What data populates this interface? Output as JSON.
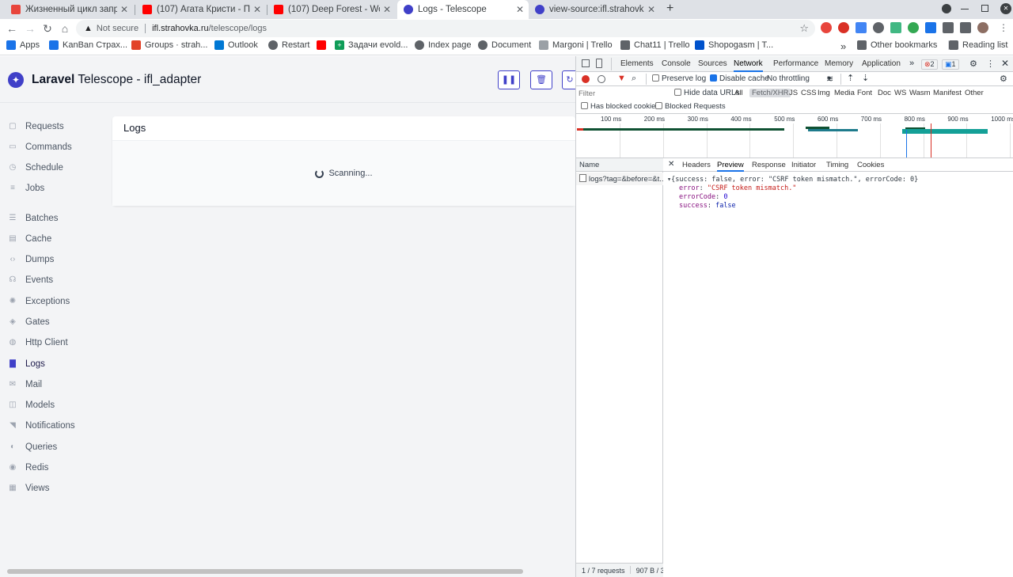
{
  "browser": {
    "tabs": [
      {
        "title": "Жизненный цикл запрос",
        "color": "#e8453c"
      },
      {
        "title": "(107) Агата Кристи - Пуля",
        "color": "#ff0000"
      },
      {
        "title": "(107) Deep Forest - World",
        "color": "#ff0000"
      },
      {
        "title": "Logs - Telescope",
        "color": "#4040c8"
      },
      {
        "title": "view-source:ifl.strahovka",
        "color": "#4040c8"
      }
    ],
    "new_tab": "+",
    "close": "✕",
    "not_secure": "Not secure",
    "url_host": "ifl.strahovka.ru",
    "url_path": "/telescope/logs",
    "bookmarks": [
      {
        "label": "Apps",
        "color": "#1a73e8"
      },
      {
        "label": "KanBan Страх...",
        "color": "#1a73e8"
      },
      {
        "label": "Groups · strah...",
        "color": "#e24329"
      },
      {
        "label": "Outlook",
        "color": "#0078d4"
      },
      {
        "label": "Restart",
        "color": "#5f6368"
      },
      {
        "label": "",
        "color": "#ff0000"
      },
      {
        "label": "Задачи evold...",
        "color": "#0f9d58"
      },
      {
        "label": "Index page",
        "color": "#5f6368"
      },
      {
        "label": "Document",
        "color": "#5f6368"
      },
      {
        "label": "Margoni | Trello",
        "color": "#9aa0a6"
      },
      {
        "label": "Chat11 | Trello",
        "color": "#5f6368"
      },
      {
        "label": "Shopogasm | T...",
        "color": "#0052cc"
      }
    ],
    "more_bookmarks": "»",
    "other_bookmarks": "Other bookmarks",
    "reading_list": "Reading list"
  },
  "app": {
    "brand": "Laravel",
    "title": "Telescope - ifl_adapter",
    "nav": [
      {
        "label": "Requests",
        "icon": "requests-icon"
      },
      {
        "label": "Commands",
        "icon": "commands-icon"
      },
      {
        "label": "Schedule",
        "icon": "schedule-icon"
      },
      {
        "label": "Jobs",
        "icon": "jobs-icon"
      },
      {
        "label": "Batches",
        "icon": "batches-icon"
      },
      {
        "label": "Cache",
        "icon": "cache-icon"
      },
      {
        "label": "Dumps",
        "icon": "dumps-icon"
      },
      {
        "label": "Events",
        "icon": "events-icon"
      },
      {
        "label": "Exceptions",
        "icon": "exceptions-icon"
      },
      {
        "label": "Gates",
        "icon": "gates-icon"
      },
      {
        "label": "Http Client",
        "icon": "http-client-icon"
      },
      {
        "label": "Logs",
        "icon": "logs-icon",
        "active": true
      },
      {
        "label": "Mail",
        "icon": "mail-icon"
      },
      {
        "label": "Models",
        "icon": "models-icon"
      },
      {
        "label": "Notifications",
        "icon": "notifications-icon"
      },
      {
        "label": "Queries",
        "icon": "queries-icon"
      },
      {
        "label": "Redis",
        "icon": "redis-icon"
      },
      {
        "label": "Views",
        "icon": "views-icon"
      }
    ],
    "card_title": "Logs",
    "scanning": "Scanning..."
  },
  "devtools": {
    "tabs": [
      "Elements",
      "Console",
      "Sources",
      "Network",
      "Performance",
      "Memory",
      "Application"
    ],
    "active_tab": "Network",
    "error_count": "2",
    "message_count": "1",
    "preserve_log": "Preserve log",
    "disable_cache": "Disable cache",
    "throttling": "No throttling",
    "filter_placeholder": "Filter",
    "hide_data_urls": "Hide data URLs",
    "types": [
      "All",
      "Fetch/XHR",
      "JS",
      "CSS",
      "Img",
      "Media",
      "Font",
      "Doc",
      "WS",
      "Wasm",
      "Manifest",
      "Other"
    ],
    "selected_type": "Fetch/XHR",
    "has_blocked_cookies": "Has blocked cookies",
    "blocked_requests": "Blocked Requests",
    "timeline_ticks": [
      "100 ms",
      "200 ms",
      "300 ms",
      "400 ms",
      "500 ms",
      "600 ms",
      "700 ms",
      "800 ms",
      "900 ms",
      "1000 ms"
    ],
    "name_header": "Name",
    "request_name": "logs?tag=&before=&t...",
    "detail_tabs": [
      "Headers",
      "Preview",
      "Response",
      "Initiator",
      "Timing",
      "Cookies"
    ],
    "active_detail_tab": "Preview",
    "preview_summary": "{success: false, error: \"CSRF token mismatch.\", errorCode: 0}",
    "preview_lines": [
      {
        "key": "error",
        "value": "\"CSRF token mismatch.\"",
        "color": "#c41a16"
      },
      {
        "key": "errorCode",
        "value": "0",
        "color": "#1c00cf"
      },
      {
        "key": "success",
        "value": "false",
        "color": "#0d22aa"
      }
    ],
    "status_requests": "1 / 7 requests",
    "status_size": "907 B / 3("
  }
}
